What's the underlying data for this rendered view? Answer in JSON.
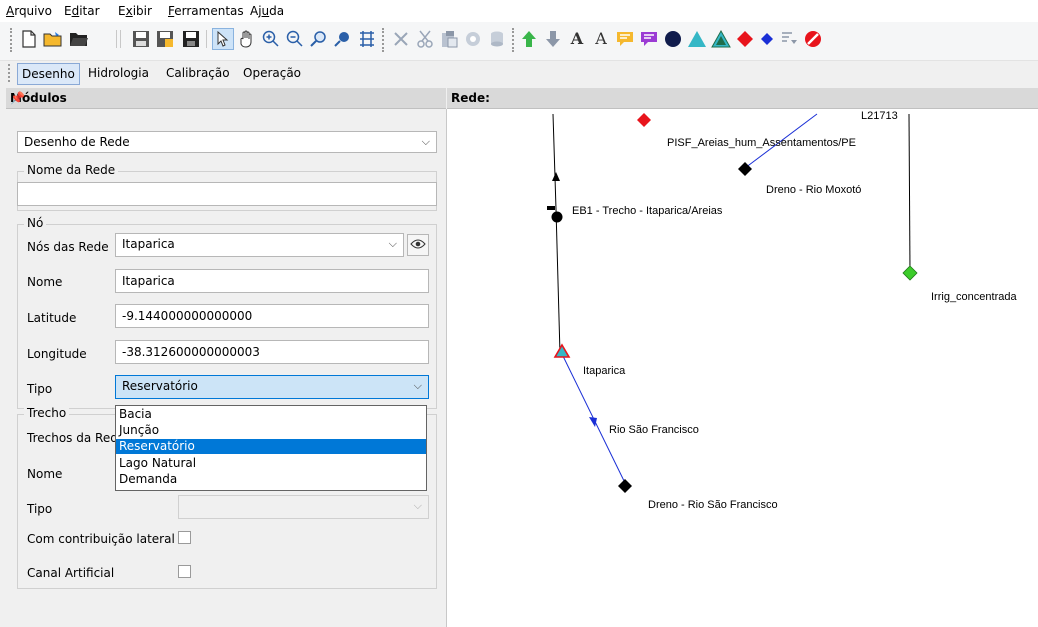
{
  "menu": {
    "items": [
      {
        "pre": "",
        "u": "A",
        "post": "rquivo"
      },
      {
        "pre": "E",
        "u": "d",
        "post": "itar"
      },
      {
        "pre": "E",
        "u": "x",
        "post": "ibir"
      },
      {
        "pre": "",
        "u": "F",
        "post": "erramentas"
      },
      {
        "pre": "Aj",
        "u": "u",
        "post": "da"
      }
    ]
  },
  "tabs": [
    "Desenho",
    "Hidrologia",
    "Calibração",
    "Operação"
  ],
  "modules_panel": {
    "title": "Módulos",
    "module_select": "Desenho de Rede",
    "network_name_group": "Nome da Rede",
    "network_name_value": "",
    "node_group": "Nó",
    "node_fields": {
      "nodes_label": "Nós das Rede",
      "nodes_value": "Itaparica",
      "name_label": "Nome",
      "name_value": "Itaparica",
      "lat_label": "Latitude",
      "lat_value": "-9.144000000000000",
      "lon_label": "Longitude",
      "lon_value": "-38.312600000000003",
      "type_label": "Tipo",
      "type_value": "Reservatório"
    },
    "type_options": [
      "Bacia",
      "Junção",
      "Reservatório",
      "Lago Natural",
      "Demanda"
    ],
    "type_selected_index": 2,
    "reach_group": "Trecho",
    "reach_fields": {
      "reaches_label": "Trechos da Rede",
      "name_label": "Nome",
      "type_label": "Tipo",
      "lateral_label": "Com contribuição lateral",
      "canal_label": "Canal Artificial"
    }
  },
  "map_panel": {
    "title": "Rede:",
    "labels": {
      "top_partial": "L21713",
      "pisf": "PISF_Areias_hum_Assentamentos/PE",
      "dreno_moxoto": "Dreno - Rio Moxotó",
      "eb1": "EB1 - Trecho - Itaparica/Areias",
      "irrig": "Irrig_concentrada",
      "itaparica": "Itaparica",
      "rio_sf": "Rio São Francisco",
      "dreno_sf": "Dreno - Rio São Francisco"
    },
    "colors": {
      "demand": "#e8141c",
      "drain": "#000000",
      "junction": "#3ccc2a",
      "reservoir_fill": "#35b7c6",
      "reservoir_edge": "#e8141c",
      "river": "#1a2fd6"
    }
  }
}
